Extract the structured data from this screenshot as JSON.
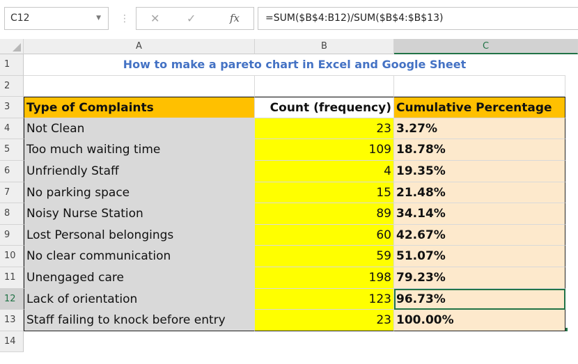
{
  "formula_bar": {
    "name_box": "C12",
    "formula": "=SUM($B$4:B12)/SUM($B$4:$B$13)"
  },
  "columns": [
    "A",
    "B",
    "C"
  ],
  "title": "How to make a pareto chart in Excel and Google Sheet",
  "headers": {
    "a": "Type of Complaints",
    "b": "Count (frequency)",
    "c": "Cumulative Percentage"
  },
  "rows": [
    {
      "num": "4",
      "a": "Not Clean",
      "b": "23",
      "c": "3.27%"
    },
    {
      "num": "5",
      "a": "Too much waiting time",
      "b": "109",
      "c": "18.78%"
    },
    {
      "num": "6",
      "a": "Unfriendly Staff",
      "b": "4",
      "c": "19.35%"
    },
    {
      "num": "7",
      "a": "No parking space",
      "b": "15",
      "c": "21.48%"
    },
    {
      "num": "8",
      "a": "Noisy Nurse Station",
      "b": "89",
      "c": "34.14%"
    },
    {
      "num": "9",
      "a": "Lost Personal belongings",
      "b": "60",
      "c": "42.67%"
    },
    {
      "num": "10",
      "a": "No clear communication",
      "b": "59",
      "c": "51.07%"
    },
    {
      "num": "11",
      "a": "Unengaged care",
      "b": "198",
      "c": "79.23%"
    },
    {
      "num": "12",
      "a": "Lack of orientation",
      "b": "123",
      "c": "96.73%"
    },
    {
      "num": "13",
      "a": "Staff failing to knock before entry",
      "b": "23",
      "c": "100.00%"
    }
  ],
  "row_numbers": [
    "1",
    "2",
    "3",
    "14"
  ],
  "colors": {
    "accent": "#217346",
    "title": "#4472c4",
    "count_fill": "#ffff00",
    "cumulative_fill": "#fde9cc",
    "header_fill": "#ffc000",
    "type_fill": "#d9d9d9"
  },
  "icons": {
    "cancel": "✕",
    "enter": "✓",
    "function": "fx"
  }
}
